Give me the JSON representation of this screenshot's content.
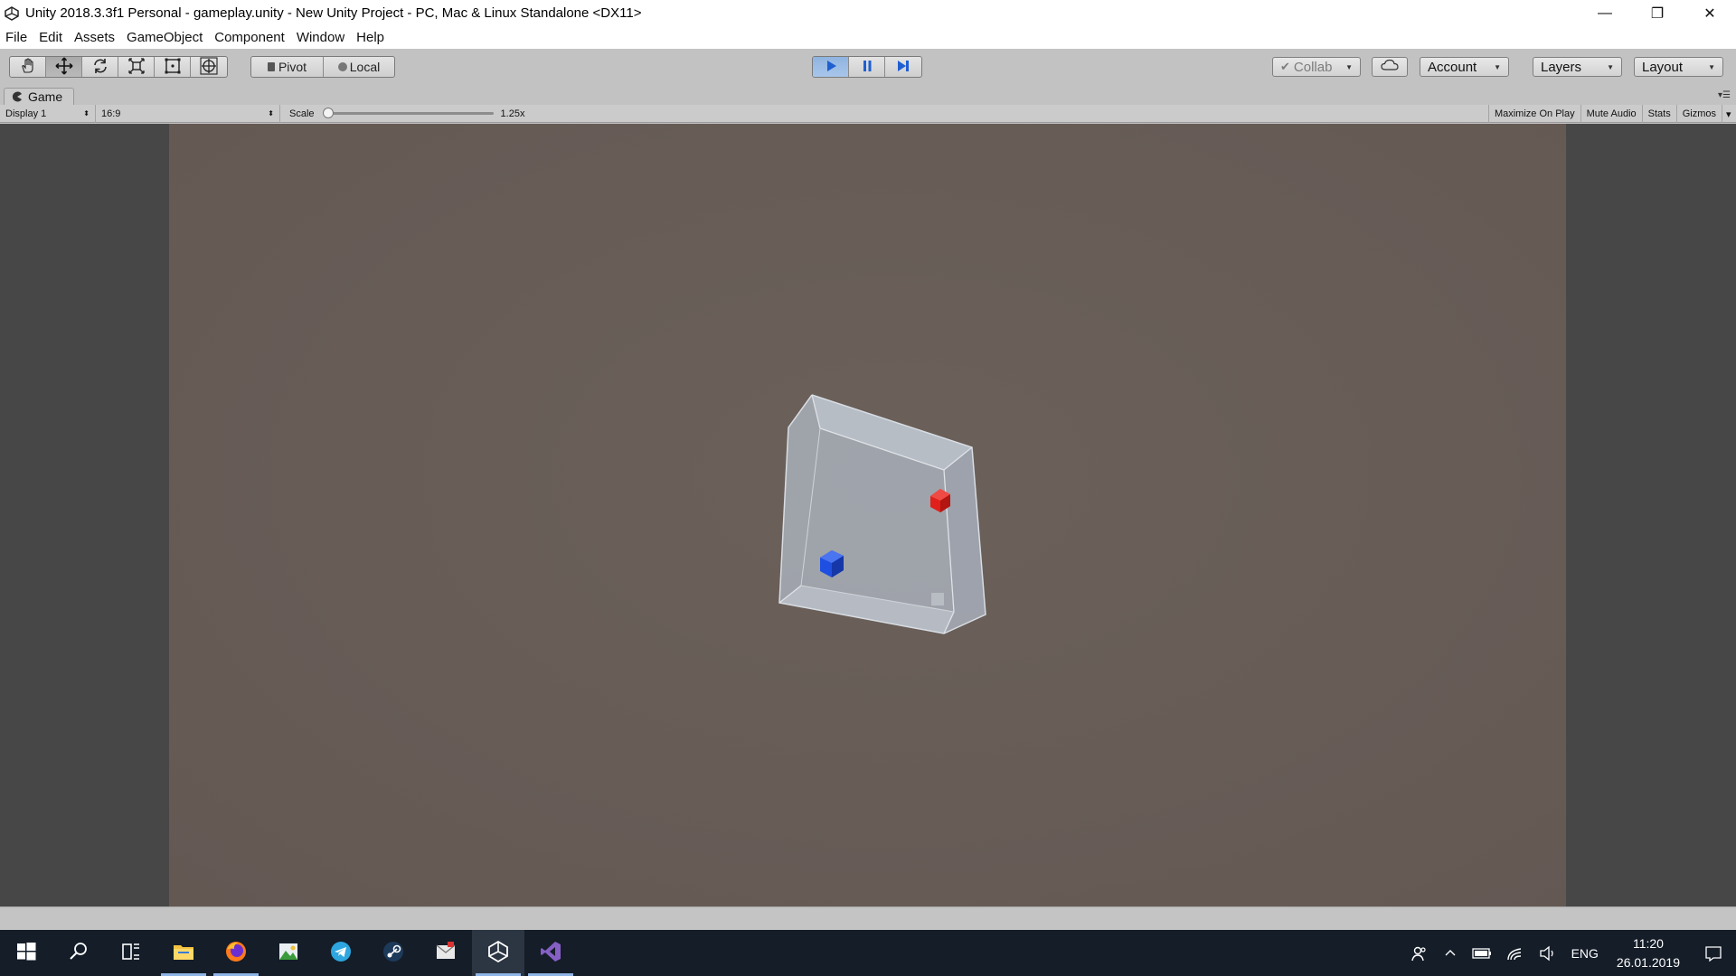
{
  "window": {
    "title": "Unity 2018.3.3f1 Personal - gameplay.unity - New Unity Project - PC, Mac & Linux Standalone <DX11>",
    "controls": {
      "minimize": "—",
      "restore": "❐",
      "close": "✕"
    }
  },
  "menu": {
    "items": [
      "File",
      "Edit",
      "Assets",
      "GameObject",
      "Component",
      "Window",
      "Help"
    ]
  },
  "toolbar": {
    "tools": [
      "hand-tool",
      "move-tool",
      "rotate-tool",
      "scale-tool",
      "rect-tool",
      "transform-tool"
    ],
    "active_tool": "move-tool",
    "pivot_label": "Pivot",
    "local_label": "Local",
    "play_state": "playing",
    "collab_label": "Collab",
    "account_label": "Account",
    "layers_label": "Layers",
    "layout_label": "Layout"
  },
  "game_panel": {
    "tab_label": "Game",
    "display_label": "Display 1",
    "aspect_label": "16:9",
    "scale_label": "Scale",
    "scale_value": "1.25x",
    "scale_fraction": 0.0,
    "maximize_label": "Maximize On Play",
    "mute_label": "Mute Audio",
    "stats_label": "Stats",
    "gizmos_label": "Gizmos"
  },
  "scene_colors": {
    "background": "#675c56",
    "glass_box": "#b4bcc6",
    "red_cube": "#e0201a",
    "blue_cube": "#1f4fe0"
  },
  "taskbar": {
    "apps": [
      "windows-start",
      "search",
      "task-view",
      "file-explorer",
      "firefox",
      "image-editor",
      "telegram",
      "steam",
      "mail-app",
      "unity",
      "visual-studio"
    ],
    "active_apps": [
      "unity"
    ],
    "tray_lang": "ENG",
    "time": "11:20",
    "date": "26.01.2019"
  }
}
